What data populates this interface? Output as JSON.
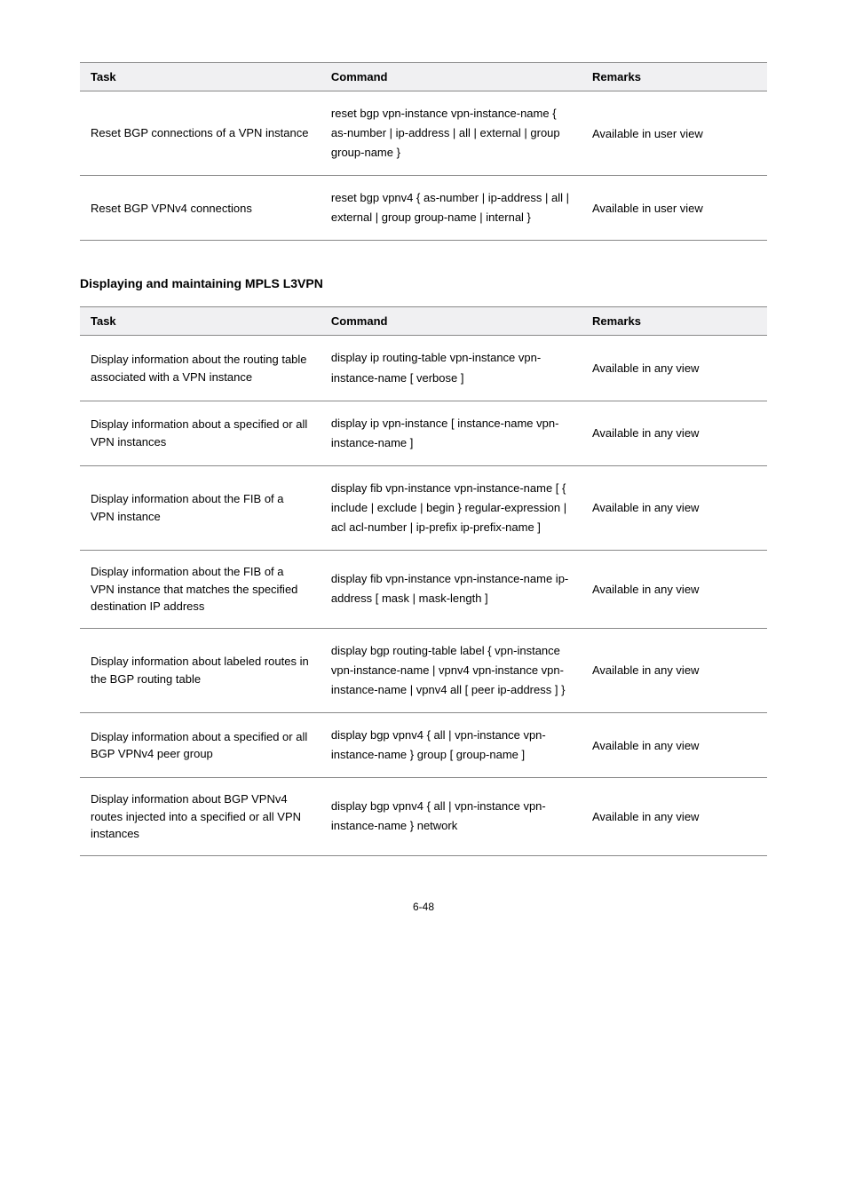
{
  "table1": {
    "headers": {
      "task": "Task",
      "command": "Command",
      "remarks": "Remarks"
    },
    "rows": [
      {
        "task": "Reset BGP connections of a VPN instance",
        "command": "reset bgp vpn-instance vpn-instance-name { as-number | ip-address | all | external | group group-name }",
        "remarks": "Available in user view"
      },
      {
        "task": "Reset BGP VPNv4 connections",
        "command": "reset bgp vpnv4 { as-number | ip-address | all | external | group group-name | internal }",
        "remarks": "Available in user view"
      }
    ]
  },
  "sectionHeading": "Displaying and maintaining MPLS L3VPN",
  "table2": {
    "headers": {
      "task": "Task",
      "command": "Command",
      "remarks": "Remarks"
    },
    "rows": [
      {
        "task": "Display information about the routing table associated with a VPN instance",
        "command": "display ip routing-table vpn-instance vpn-instance-name [ verbose ]",
        "remarks": "Available in any view"
      },
      {
        "task": "Display information about a specified or all VPN instances",
        "command": "display ip vpn-instance [ instance-name vpn-instance-name ]",
        "remarks": "Available in any view"
      },
      {
        "task": "Display information about the FIB of a VPN instance",
        "command": "display fib vpn-instance vpn-instance-name [ { include | exclude | begin } regular-expression | acl acl-number | ip-prefix ip-prefix-name ]",
        "remarks": "Available in any view"
      },
      {
        "task": "Display information about the FIB of a VPN instance that matches the specified destination IP address",
        "command": "display fib vpn-instance vpn-instance-name ip-address [ mask | mask-length ]",
        "remarks": "Available in any view"
      },
      {
        "task": "Display information about labeled routes in the BGP routing table",
        "command": "display bgp routing-table label { vpn-instance vpn-instance-name | vpnv4 vpn-instance vpn-instance-name | vpnv4 all [ peer ip-address ] }",
        "remarks": "Available in any view"
      },
      {
        "task": "Display information about a specified or all BGP VPNv4 peer group",
        "command": "display bgp vpnv4 { all | vpn-instance vpn-instance-name } group [ group-name ]",
        "remarks": "Available in any view"
      },
      {
        "task": "Display information about BGP VPNv4 routes injected into a specified or all VPN instances",
        "command": "display bgp vpnv4 { all | vpn-instance vpn-instance-name } network",
        "remarks": "Available in any view"
      }
    ]
  },
  "pageNumber": "6-48"
}
